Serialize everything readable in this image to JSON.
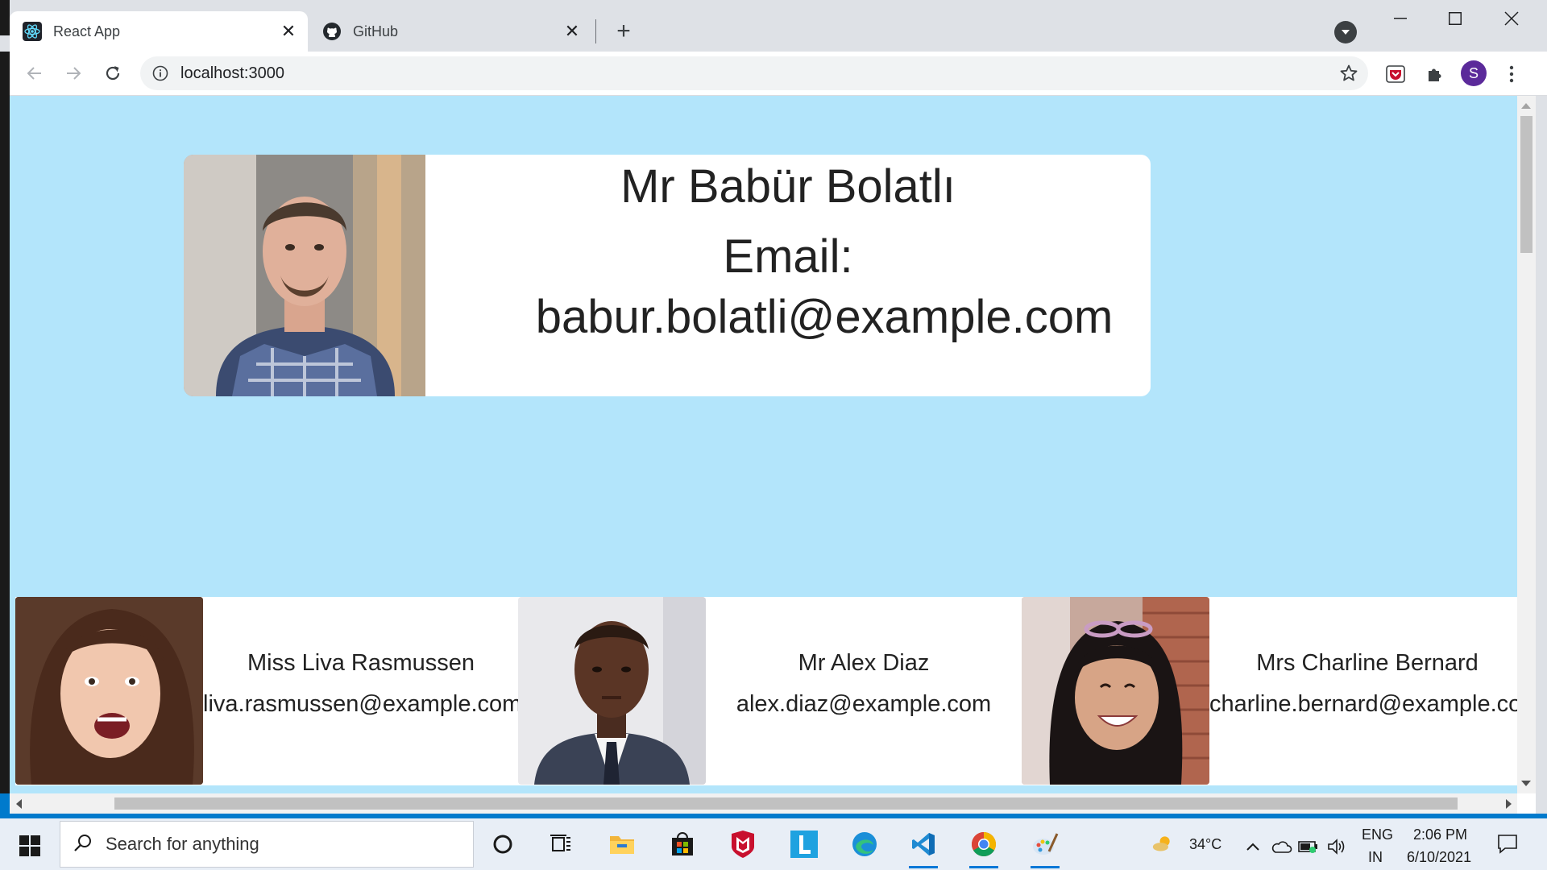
{
  "browser": {
    "tabs": [
      {
        "title": "React App",
        "active": true,
        "favicon": "react-logo-icon"
      },
      {
        "title": "GitHub",
        "active": false,
        "favicon": "github-icon"
      }
    ],
    "url": "localhost:3000",
    "profile_initial": "S"
  },
  "page": {
    "background": "#b3e5fb",
    "main_user": {
      "name": "Mr Babür Bolatlı",
      "email_label": "Email:",
      "email": "babur.bolatli@example.com"
    },
    "users": [
      {
        "name": "Miss Liva Rasmussen",
        "email": "liva.rasmussen@example.com"
      },
      {
        "name": "Mr Alex Diaz",
        "email": "alex.diaz@example.com"
      },
      {
        "name": "Mrs Charline Bernard",
        "email": "charline.bernard@example.com"
      }
    ]
  },
  "taskbar": {
    "search_placeholder": "Search for anything",
    "weather": "34°C",
    "language": "ENG",
    "region": "IN",
    "time": "2:06 PM",
    "date": "6/10/2021",
    "apps": [
      "cortana-icon",
      "task-view-icon",
      "file-explorer-icon",
      "store-icon",
      "mcafee-icon",
      "l-app-icon",
      "edge-icon",
      "vscode-icon",
      "chrome-icon",
      "paint-icon"
    ]
  }
}
